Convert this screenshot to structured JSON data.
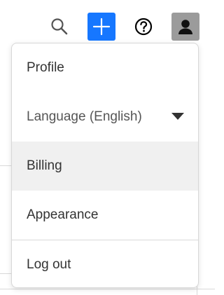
{
  "toolbar": {
    "icons": {
      "search": "search-icon",
      "add": "plus-icon",
      "help": "help-circle-icon",
      "account": "user-icon"
    },
    "colors": {
      "add_bg": "#1677ff",
      "account_bg": "#9b9b9b",
      "icon_dark": "#000000"
    }
  },
  "menu": {
    "items": [
      {
        "label": "Profile"
      },
      {
        "label": "Language (English)"
      },
      {
        "label": "Billing"
      },
      {
        "label": "Appearance"
      },
      {
        "label": "Log out"
      }
    ],
    "colors": {
      "hover_bg": "#f0f0f0",
      "divider": "#d9d9d9"
    }
  }
}
